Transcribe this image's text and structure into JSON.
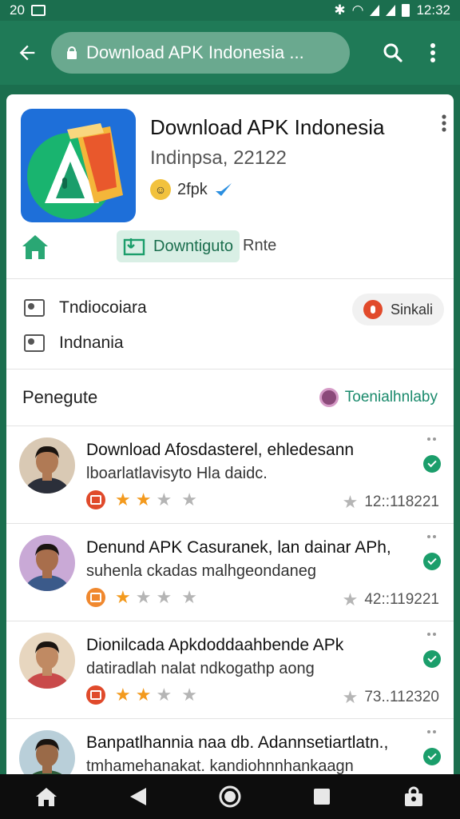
{
  "status_bar": {
    "left_text": "20",
    "time": "12:32"
  },
  "app_bar": {
    "url_text": "Download APK Indonesia ..."
  },
  "app": {
    "title": "Download APK Indonesia",
    "subtitle": "Indinpsa, 22122",
    "meta_text": "2fpk",
    "download_label": "Downtiguto",
    "rate_label": "Rnte"
  },
  "info": {
    "row1": "Tndiocoiara",
    "row2": "Indnania",
    "chip_label": "Sinkali"
  },
  "section": {
    "title": "Penegute",
    "link_label": "Toenialhnlaby"
  },
  "reviews": [
    {
      "line1": "Download Afosdasterel, ehledesann",
      "line2": "lboarlatlavisyto Hla daidc.",
      "rating": 2,
      "badge_color": "#e04a2b",
      "date": "12::118221",
      "avatar_bg": "#d9c9b4",
      "skin": "#b07a55",
      "shirt": "#2b2f3a"
    },
    {
      "line1": "Denund APK Casuranek, lan dainar APh,",
      "line2": "suhenla ckadas malhgeondaneg",
      "rating": 1,
      "badge_color": "#f0882e",
      "date": "42::119221",
      "avatar_bg": "#c9a9d6",
      "skin": "#a86e4c",
      "shirt": "#3b5a8a"
    },
    {
      "line1": "Dionilcada Apkdoddaahbende APk",
      "line2": "datiradlah nalat ndkogathp aong",
      "rating": 2,
      "badge_color": "#e04a2b",
      "date": "73..112320",
      "avatar_bg": "#e7d6bf",
      "skin": "#c08a63",
      "shirt": "#c94a4a"
    },
    {
      "line1": "Banpatlhannia naa db. Adannsetiartlatn.,",
      "line2": "tmhamehanakat. kandiohnnhankaagn",
      "rating": 0,
      "badge_color": "#e04a2b",
      "date": "",
      "avatar_bg": "#b9cfd9",
      "skin": "#9a6a48",
      "shirt": "#2f5d3a"
    }
  ],
  "icons": {
    "back": "arrow-left-icon",
    "search": "search-icon",
    "more": "more-vert-icon",
    "home": "home-icon",
    "download": "download-icon",
    "verified": "verified-icon",
    "check": "check-circle-icon",
    "star": "star-icon"
  },
  "colors": {
    "primary": "#1f7a57",
    "accent": "#1b9e6b",
    "star": "#f39a1e"
  }
}
